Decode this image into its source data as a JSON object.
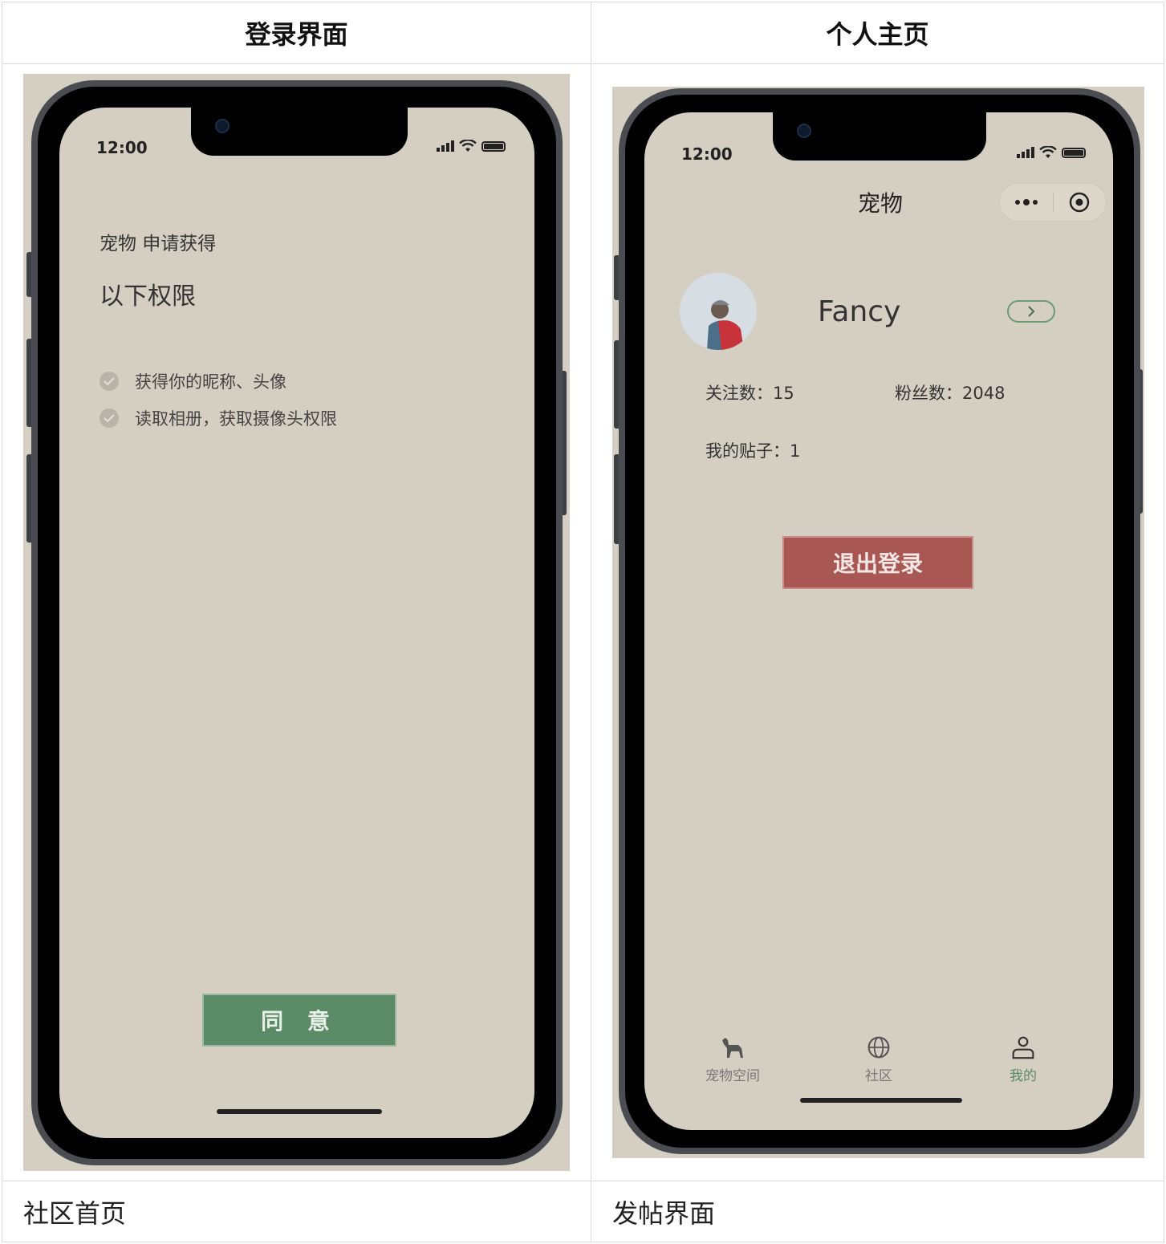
{
  "table": {
    "header_left": "登录界面",
    "header_right": "个人主页",
    "footer_left": "社区首页",
    "footer_right": "发帖界面"
  },
  "login_screen": {
    "time": "12:00",
    "title_line1": "宠物 申请获得",
    "title_line2": "以下权限",
    "permissions": [
      "获得你的昵称、头像",
      "读取相册，获取摄像头权限"
    ],
    "agree_label": "同 意"
  },
  "profile_screen": {
    "time": "12:00",
    "nav_title": "宠物",
    "username": "Fancy",
    "following": "关注数：15",
    "followers": "粉丝数：2048",
    "posts": "我的贴子：1",
    "logout_label": "退出登录",
    "tabs": [
      {
        "label": "宠物空间",
        "icon": "dog-icon"
      },
      {
        "label": "社区",
        "icon": "globe-icon"
      },
      {
        "label": "我的",
        "icon": "user-icon"
      }
    ]
  },
  "colors": {
    "screen_bg": "#d5cec3",
    "agree_green": "#5a8a66",
    "logout_red": "#a95752",
    "active_tab": "#5a8a66"
  }
}
